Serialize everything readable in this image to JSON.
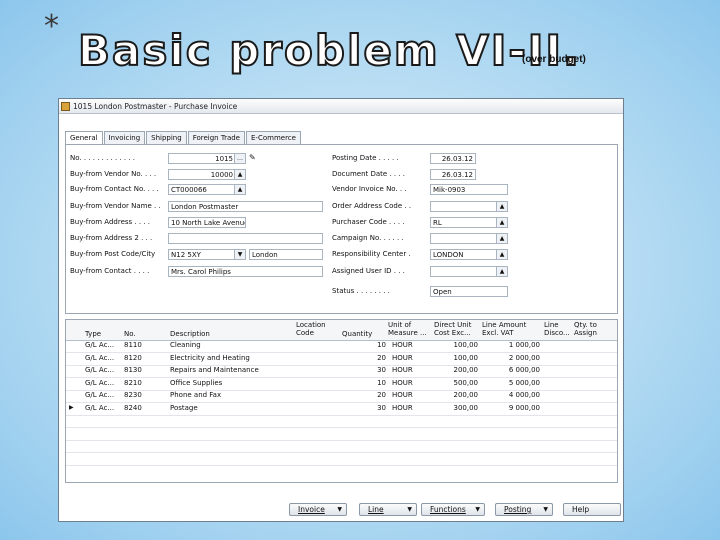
{
  "slide": {
    "asterisk": "*",
    "title": "Basic problem VI-II.",
    "subtitle": "(over budget)"
  },
  "window": {
    "title": "1015 London Postmaster - Purchase Invoice"
  },
  "tabs": [
    "General",
    "Invoicing",
    "Shipping",
    "Foreign Trade",
    "E-Commerce"
  ],
  "left_fields": [
    {
      "label": "No. . . . . . . . . . . . .",
      "value": "1015"
    },
    {
      "label": "Buy-from Vendor No. . . .",
      "value": "10000"
    },
    {
      "label": "Buy-from Contact No. . . .",
      "value": "CT000066"
    },
    {
      "label": "Buy-from Vendor Name . .",
      "value": "London Postmaster"
    },
    {
      "label": "Buy-from Address . . . .",
      "value": "10 North Lake Avenue"
    },
    {
      "label": "Buy-from Address 2 . . .",
      "value": ""
    },
    {
      "label": "Buy-from Post Code/City",
      "value": "N12 5XY",
      "value2": "London"
    },
    {
      "label": "Buy-from Contact . . . .",
      "value": "Mrs. Carol Philips"
    }
  ],
  "right_fields": [
    {
      "label": "Posting Date . . . . .",
      "value": "26.03.12"
    },
    {
      "label": "Document Date . . . .",
      "value": "26.03.12"
    },
    {
      "label": "Vendor Invoice No. . .",
      "value": "Mik-0903"
    },
    {
      "label": "Order Address Code . .",
      "value": ""
    },
    {
      "label": "Purchaser Code . . . .",
      "value": "RL"
    },
    {
      "label": "Campaign No. . . . . .",
      "value": ""
    },
    {
      "label": "Responsibility Center .",
      "value": "LONDON"
    },
    {
      "label": "Assigned User ID . . .",
      "value": ""
    },
    {
      "label": "Status . . . . . . . .",
      "value": "Open"
    }
  ],
  "line_headers": [
    "Type",
    "No.",
    "Description",
    "Location Code",
    "Quantity",
    "Unit of Measure ...",
    "Direct Unit Cost Exc...",
    "Line Amount Excl. VAT",
    "Line Disco...",
    "Qty. to Assign"
  ],
  "lines": [
    {
      "type": "G/L Ac...",
      "no": "8110",
      "desc": "Cleaning",
      "qty": "10",
      "uom": "HOUR",
      "cost": "100,00",
      "amount": "1 000,00"
    },
    {
      "type": "G/L Ac...",
      "no": "8120",
      "desc": "Electricity and Heating",
      "qty": "20",
      "uom": "HOUR",
      "cost": "100,00",
      "amount": "2 000,00"
    },
    {
      "type": "G/L Ac...",
      "no": "8130",
      "desc": "Repairs and Maintenance",
      "qty": "30",
      "uom": "HOUR",
      "cost": "200,00",
      "amount": "6 000,00"
    },
    {
      "type": "G/L Ac...",
      "no": "8210",
      "desc": "Office Supplies",
      "qty": "10",
      "uom": "HOUR",
      "cost": "500,00",
      "amount": "5 000,00"
    },
    {
      "type": "G/L Ac...",
      "no": "8230",
      "desc": "Phone and Fax",
      "qty": "20",
      "uom": "HOUR",
      "cost": "200,00",
      "amount": "4 000,00"
    },
    {
      "type": "G/L Ac...",
      "no": "8240",
      "desc": "Postage",
      "qty": "30",
      "uom": "HOUR",
      "cost": "300,00",
      "amount": "9 000,00"
    }
  ],
  "footer_buttons": [
    "Invoice",
    "Line",
    "Functions",
    "Posting",
    "Help"
  ]
}
